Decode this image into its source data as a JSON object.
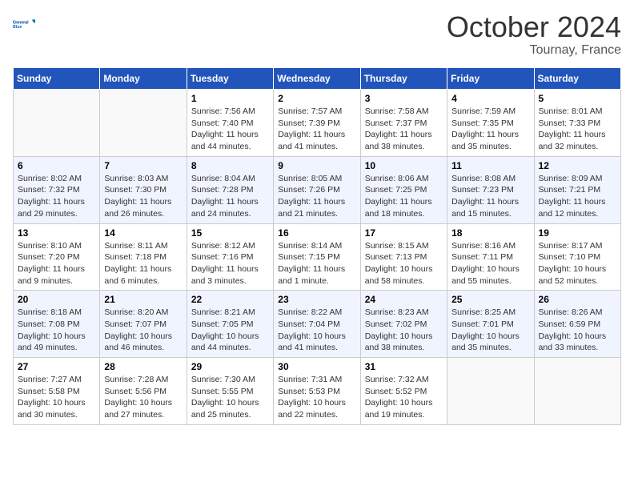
{
  "header": {
    "logo_line1": "General",
    "logo_line2": "Blue",
    "month": "October 2024",
    "location": "Tournay, France"
  },
  "days_of_week": [
    "Sunday",
    "Monday",
    "Tuesday",
    "Wednesday",
    "Thursday",
    "Friday",
    "Saturday"
  ],
  "weeks": [
    [
      {
        "day": "",
        "sunrise": "",
        "sunset": "",
        "daylight": ""
      },
      {
        "day": "",
        "sunrise": "",
        "sunset": "",
        "daylight": ""
      },
      {
        "day": "1",
        "sunrise": "Sunrise: 7:56 AM",
        "sunset": "Sunset: 7:40 PM",
        "daylight": "Daylight: 11 hours and 44 minutes."
      },
      {
        "day": "2",
        "sunrise": "Sunrise: 7:57 AM",
        "sunset": "Sunset: 7:39 PM",
        "daylight": "Daylight: 11 hours and 41 minutes."
      },
      {
        "day": "3",
        "sunrise": "Sunrise: 7:58 AM",
        "sunset": "Sunset: 7:37 PM",
        "daylight": "Daylight: 11 hours and 38 minutes."
      },
      {
        "day": "4",
        "sunrise": "Sunrise: 7:59 AM",
        "sunset": "Sunset: 7:35 PM",
        "daylight": "Daylight: 11 hours and 35 minutes."
      },
      {
        "day": "5",
        "sunrise": "Sunrise: 8:01 AM",
        "sunset": "Sunset: 7:33 PM",
        "daylight": "Daylight: 11 hours and 32 minutes."
      }
    ],
    [
      {
        "day": "6",
        "sunrise": "Sunrise: 8:02 AM",
        "sunset": "Sunset: 7:32 PM",
        "daylight": "Daylight: 11 hours and 29 minutes."
      },
      {
        "day": "7",
        "sunrise": "Sunrise: 8:03 AM",
        "sunset": "Sunset: 7:30 PM",
        "daylight": "Daylight: 11 hours and 26 minutes."
      },
      {
        "day": "8",
        "sunrise": "Sunrise: 8:04 AM",
        "sunset": "Sunset: 7:28 PM",
        "daylight": "Daylight: 11 hours and 24 minutes."
      },
      {
        "day": "9",
        "sunrise": "Sunrise: 8:05 AM",
        "sunset": "Sunset: 7:26 PM",
        "daylight": "Daylight: 11 hours and 21 minutes."
      },
      {
        "day": "10",
        "sunrise": "Sunrise: 8:06 AM",
        "sunset": "Sunset: 7:25 PM",
        "daylight": "Daylight: 11 hours and 18 minutes."
      },
      {
        "day": "11",
        "sunrise": "Sunrise: 8:08 AM",
        "sunset": "Sunset: 7:23 PM",
        "daylight": "Daylight: 11 hours and 15 minutes."
      },
      {
        "day": "12",
        "sunrise": "Sunrise: 8:09 AM",
        "sunset": "Sunset: 7:21 PM",
        "daylight": "Daylight: 11 hours and 12 minutes."
      }
    ],
    [
      {
        "day": "13",
        "sunrise": "Sunrise: 8:10 AM",
        "sunset": "Sunset: 7:20 PM",
        "daylight": "Daylight: 11 hours and 9 minutes."
      },
      {
        "day": "14",
        "sunrise": "Sunrise: 8:11 AM",
        "sunset": "Sunset: 7:18 PM",
        "daylight": "Daylight: 11 hours and 6 minutes."
      },
      {
        "day": "15",
        "sunrise": "Sunrise: 8:12 AM",
        "sunset": "Sunset: 7:16 PM",
        "daylight": "Daylight: 11 hours and 3 minutes."
      },
      {
        "day": "16",
        "sunrise": "Sunrise: 8:14 AM",
        "sunset": "Sunset: 7:15 PM",
        "daylight": "Daylight: 11 hours and 1 minute."
      },
      {
        "day": "17",
        "sunrise": "Sunrise: 8:15 AM",
        "sunset": "Sunset: 7:13 PM",
        "daylight": "Daylight: 10 hours and 58 minutes."
      },
      {
        "day": "18",
        "sunrise": "Sunrise: 8:16 AM",
        "sunset": "Sunset: 7:11 PM",
        "daylight": "Daylight: 10 hours and 55 minutes."
      },
      {
        "day": "19",
        "sunrise": "Sunrise: 8:17 AM",
        "sunset": "Sunset: 7:10 PM",
        "daylight": "Daylight: 10 hours and 52 minutes."
      }
    ],
    [
      {
        "day": "20",
        "sunrise": "Sunrise: 8:18 AM",
        "sunset": "Sunset: 7:08 PM",
        "daylight": "Daylight: 10 hours and 49 minutes."
      },
      {
        "day": "21",
        "sunrise": "Sunrise: 8:20 AM",
        "sunset": "Sunset: 7:07 PM",
        "daylight": "Daylight: 10 hours and 46 minutes."
      },
      {
        "day": "22",
        "sunrise": "Sunrise: 8:21 AM",
        "sunset": "Sunset: 7:05 PM",
        "daylight": "Daylight: 10 hours and 44 minutes."
      },
      {
        "day": "23",
        "sunrise": "Sunrise: 8:22 AM",
        "sunset": "Sunset: 7:04 PM",
        "daylight": "Daylight: 10 hours and 41 minutes."
      },
      {
        "day": "24",
        "sunrise": "Sunrise: 8:23 AM",
        "sunset": "Sunset: 7:02 PM",
        "daylight": "Daylight: 10 hours and 38 minutes."
      },
      {
        "day": "25",
        "sunrise": "Sunrise: 8:25 AM",
        "sunset": "Sunset: 7:01 PM",
        "daylight": "Daylight: 10 hours and 35 minutes."
      },
      {
        "day": "26",
        "sunrise": "Sunrise: 8:26 AM",
        "sunset": "Sunset: 6:59 PM",
        "daylight": "Daylight: 10 hours and 33 minutes."
      }
    ],
    [
      {
        "day": "27",
        "sunrise": "Sunrise: 7:27 AM",
        "sunset": "Sunset: 5:58 PM",
        "daylight": "Daylight: 10 hours and 30 minutes."
      },
      {
        "day": "28",
        "sunrise": "Sunrise: 7:28 AM",
        "sunset": "Sunset: 5:56 PM",
        "daylight": "Daylight: 10 hours and 27 minutes."
      },
      {
        "day": "29",
        "sunrise": "Sunrise: 7:30 AM",
        "sunset": "Sunset: 5:55 PM",
        "daylight": "Daylight: 10 hours and 25 minutes."
      },
      {
        "day": "30",
        "sunrise": "Sunrise: 7:31 AM",
        "sunset": "Sunset: 5:53 PM",
        "daylight": "Daylight: 10 hours and 22 minutes."
      },
      {
        "day": "31",
        "sunrise": "Sunrise: 7:32 AM",
        "sunset": "Sunset: 5:52 PM",
        "daylight": "Daylight: 10 hours and 19 minutes."
      },
      {
        "day": "",
        "sunrise": "",
        "sunset": "",
        "daylight": ""
      },
      {
        "day": "",
        "sunrise": "",
        "sunset": "",
        "daylight": ""
      }
    ]
  ]
}
